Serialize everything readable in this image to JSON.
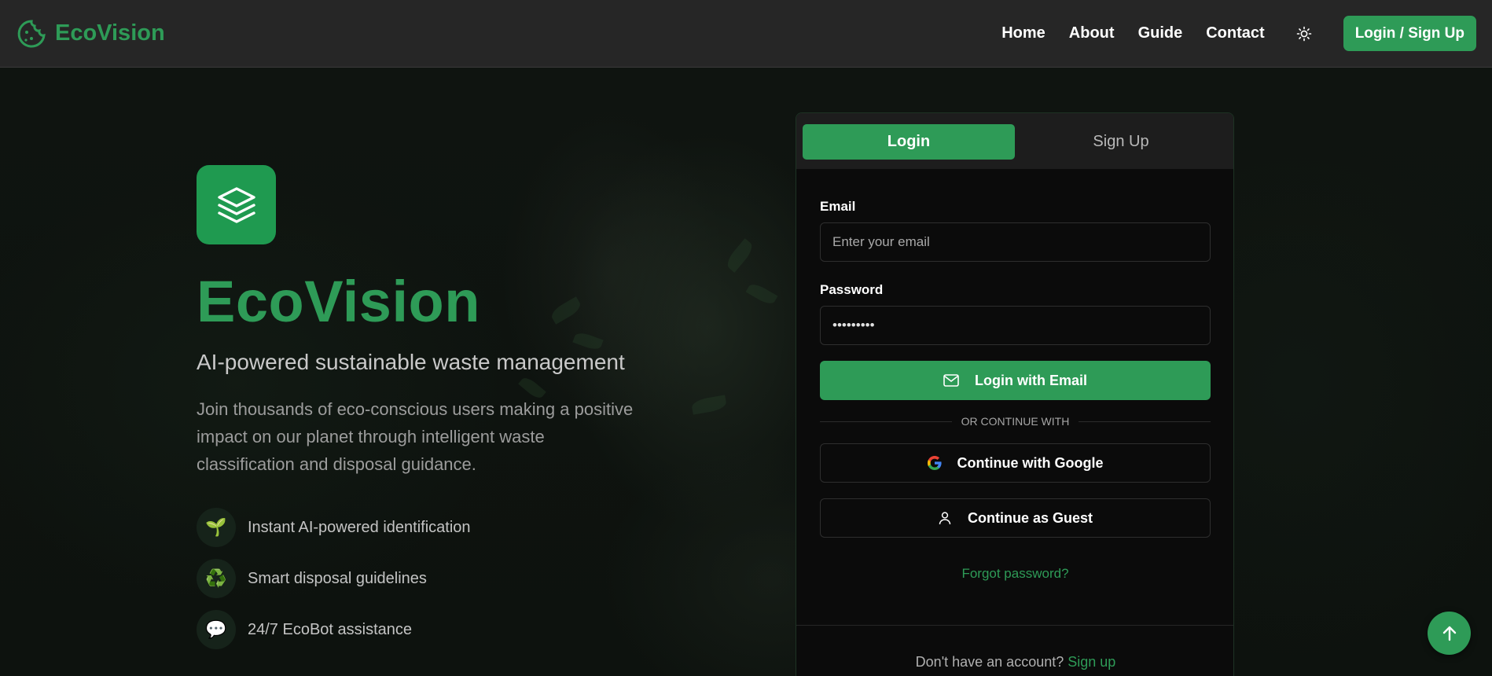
{
  "nav": {
    "brand": "EcoVision",
    "links": [
      "Home",
      "About",
      "Guide",
      "Contact"
    ],
    "cta": "Login / Sign Up",
    "theme_icon": "sun-icon"
  },
  "hero": {
    "title": "EcoVision",
    "subtitle": "AI-powered sustainable waste management",
    "description": "Join thousands of eco-conscious users making a positive impact on our planet through intelligent waste classification and disposal guidance.",
    "features": [
      {
        "icon": "🌱",
        "label": "Instant AI-powered identification"
      },
      {
        "icon": "♻️",
        "label": "Smart disposal guidelines"
      },
      {
        "icon": "💬",
        "label": "24/7 EcoBot assistance"
      }
    ]
  },
  "auth": {
    "tabs": [
      "Login",
      "Sign Up"
    ],
    "active_tab": "Login",
    "email_label": "Email",
    "email_placeholder": "Enter your email",
    "password_label": "Password",
    "password_value": "•••••••••",
    "login_button": "Login with Email",
    "divider": "OR CONTINUE WITH",
    "google_button": "Continue with Google",
    "guest_button": "Continue as Guest",
    "forgot": "Forgot password?",
    "footer_text": "Don't have an account?",
    "footer_link": "Sign up"
  },
  "colors": {
    "accent": "#2e9b57",
    "nav_bg": "#262626",
    "card_bg": "#0b0b0b"
  }
}
